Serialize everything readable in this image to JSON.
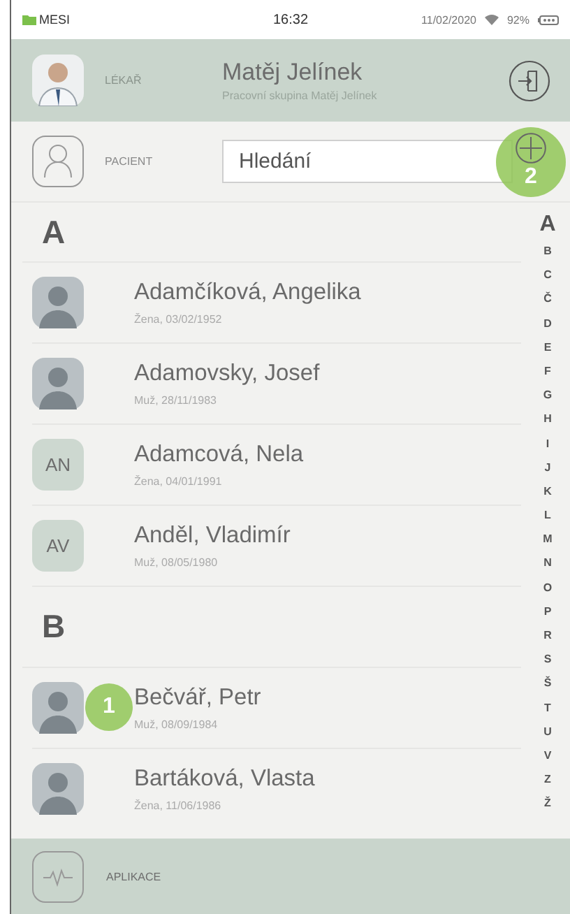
{
  "status_bar": {
    "carrier": "MESI",
    "time": "16:32",
    "date": "11/02/2020",
    "battery": "92%"
  },
  "header": {
    "role": "LÉKAŘ",
    "name": "Matěj Jelínek",
    "subtitle": "Pracovní skupina Matěj Jelínek"
  },
  "patient_bar": {
    "label": "PACIENT",
    "search": {
      "placeholder": "Hledání"
    },
    "callout": "2"
  },
  "sections": [
    {
      "letter": "A",
      "patients": [
        {
          "kind": "photo",
          "name": "Adamčíková, Angelika",
          "details": "Žena, 03/02/1952"
        },
        {
          "kind": "photo",
          "name": "Adamovsky, Josef",
          "details": "Muž, 28/11/1983"
        },
        {
          "kind": "initials",
          "initials": "AN",
          "name": "Adamcová, Nela",
          "details": "Žena, 04/01/1991"
        },
        {
          "kind": "initials",
          "initials": "AV",
          "name": "Anděl, Vladimír",
          "details": "Muž, 08/05/1980"
        }
      ]
    },
    {
      "letter": "B",
      "patients": [
        {
          "kind": "photo",
          "name": "Bečvář, Petr",
          "details": "Muž, 08/09/1984",
          "callout": "1"
        },
        {
          "kind": "photo",
          "name": "Bartáková, Vlasta",
          "details": "Žena, 11/06/1986"
        }
      ]
    }
  ],
  "index": [
    {
      "letter": "A",
      "selected": true
    },
    {
      "letter": "B",
      "selected": false
    },
    {
      "letter": "C",
      "selected": false
    },
    {
      "letter": "Č",
      "selected": false
    },
    {
      "letter": "D",
      "selected": false
    },
    {
      "letter": "E",
      "selected": false
    },
    {
      "letter": "F",
      "selected": false
    },
    {
      "letter": "G",
      "selected": false
    },
    {
      "letter": "H",
      "selected": false
    },
    {
      "letter": "I",
      "selected": false
    },
    {
      "letter": "J",
      "selected": false
    },
    {
      "letter": "K",
      "selected": false
    },
    {
      "letter": "L",
      "selected": false
    },
    {
      "letter": "M",
      "selected": false
    },
    {
      "letter": "N",
      "selected": false
    },
    {
      "letter": "O",
      "selected": false
    },
    {
      "letter": "P",
      "selected": false
    },
    {
      "letter": "R",
      "selected": false
    },
    {
      "letter": "S",
      "selected": false
    },
    {
      "letter": "Š",
      "selected": false
    },
    {
      "letter": "T",
      "selected": false
    },
    {
      "letter": "U",
      "selected": false
    },
    {
      "letter": "V",
      "selected": false
    },
    {
      "letter": "Z",
      "selected": false
    },
    {
      "letter": "Ž",
      "selected": false
    }
  ],
  "footer": {
    "label": "APLIKACE"
  }
}
